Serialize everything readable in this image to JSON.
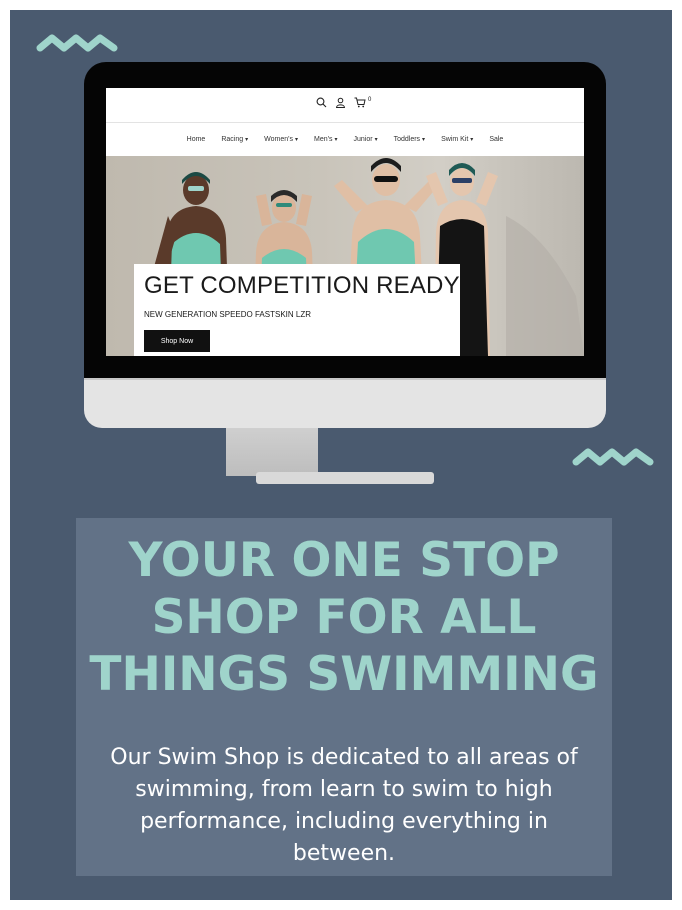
{
  "colors": {
    "background": "#4a5a6f",
    "panel": "#627287",
    "accent": "#9fd4cb",
    "text": "#ffffff"
  },
  "decorations": {
    "wave_icon": "zigzag-wave-icon"
  },
  "monitor": {
    "site": {
      "header_icons": [
        "search-icon",
        "user-icon",
        "cart-icon"
      ],
      "cart_count": "0",
      "nav": [
        {
          "label": "Home",
          "dropdown": false
        },
        {
          "label": "Racing",
          "dropdown": true
        },
        {
          "label": "Women's",
          "dropdown": true
        },
        {
          "label": "Men's",
          "dropdown": true
        },
        {
          "label": "Junior",
          "dropdown": true
        },
        {
          "label": "Toddlers",
          "dropdown": true
        },
        {
          "label": "Swim Kit",
          "dropdown": true
        },
        {
          "label": "Sale",
          "dropdown": false
        }
      ],
      "hero": {
        "title": "GET COMPETITION READY",
        "subtitle": "NEW GENERATION SPEEDO FASTSKIN LZR",
        "button_label": "Shop Now"
      }
    }
  },
  "panel": {
    "headline_lines": [
      "YOUR ONE STOP",
      "SHOP FOR ALL",
      "THINGS SWIMMING"
    ],
    "description": "Our Swim Shop is dedicated to all areas of swimming, from learn to swim to high performance, including everything in between."
  }
}
